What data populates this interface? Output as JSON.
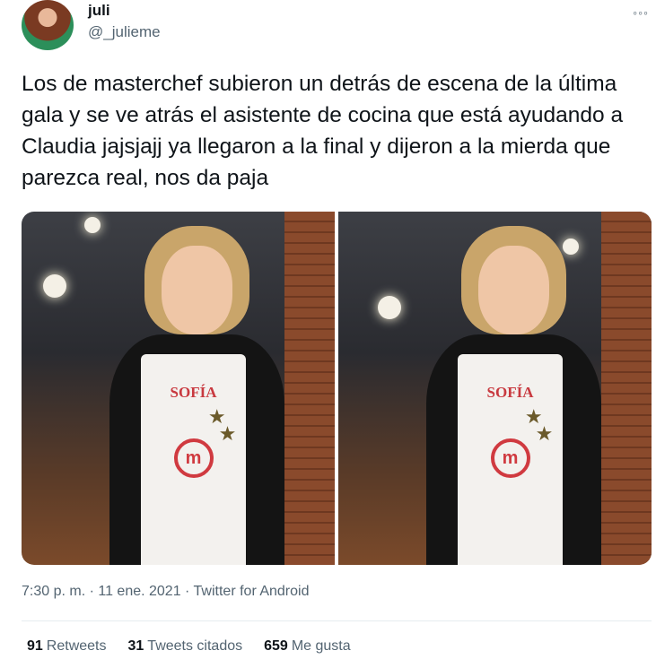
{
  "user": {
    "name": "juli",
    "handle": "@_julieme"
  },
  "more_icon": "more-icon",
  "tweet": {
    "text": "Los de masterchef subieron un detrás de escena de la última gala y se ve atrás el asistente de cocina que está ayudando a Claudia jajsjajj ya llegaron a la final y dijeron a la mierda que parezca real, nos da paja"
  },
  "media": {
    "apron_name_left": "SOFÍA",
    "apron_name_right": "SOFÍA",
    "logo_letter": "m"
  },
  "meta": {
    "line": "7:30 p. m. · 11 ene. 2021 · Twitter for Android"
  },
  "stats": {
    "retweets_count": "91",
    "retweets_label": "Retweets",
    "quotes_count": "31",
    "quotes_label": "Tweets citados",
    "likes_count": "659",
    "likes_label": "Me gusta"
  },
  "colors": {
    "text_primary": "#0f1419",
    "text_secondary": "#536471",
    "divider": "#e6ecf0"
  }
}
